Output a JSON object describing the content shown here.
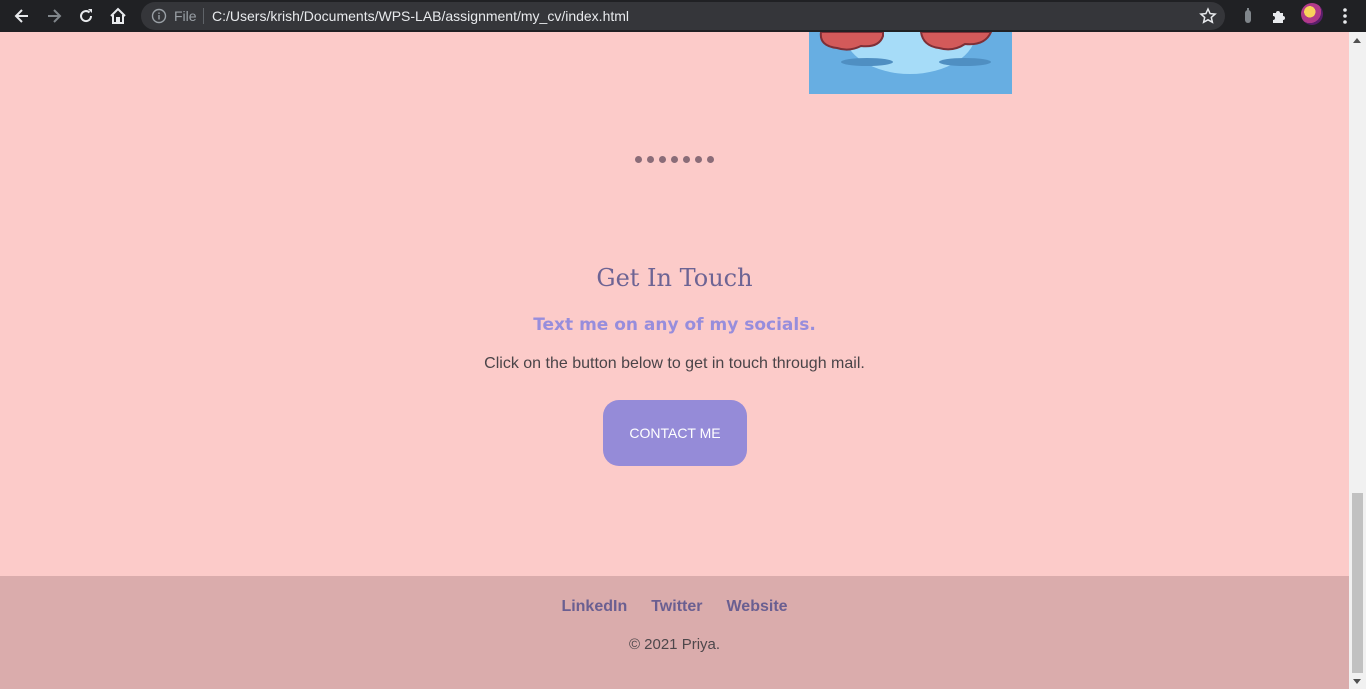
{
  "browser": {
    "omnibox_prefix": "File",
    "url": "C:/Users/krish/Documents/WPS-LAB/assignment/my_cv/index.html",
    "icons": [
      "back-icon",
      "forward-icon",
      "reload-icon",
      "home-icon",
      "info-icon",
      "star-icon",
      "extension-icon",
      "puzzle-icon",
      "avatar",
      "menu-icon"
    ]
  },
  "carousel": {
    "dot_count": 7
  },
  "contact": {
    "title": "Get In Touch",
    "subtitle": "Text me on any of my socials.",
    "description": "Click on the button below to get in touch through mail.",
    "button_label": "CONTACT ME"
  },
  "footer": {
    "links": [
      {
        "label": "LinkedIn"
      },
      {
        "label": "Twitter"
      },
      {
        "label": "Website"
      }
    ],
    "copyright": "© 2021 Priya."
  },
  "colors": {
    "page_bg": "#fccbc9",
    "footer_bg": "#daacac",
    "accent": "#958bd8",
    "title": "#6d6494"
  }
}
